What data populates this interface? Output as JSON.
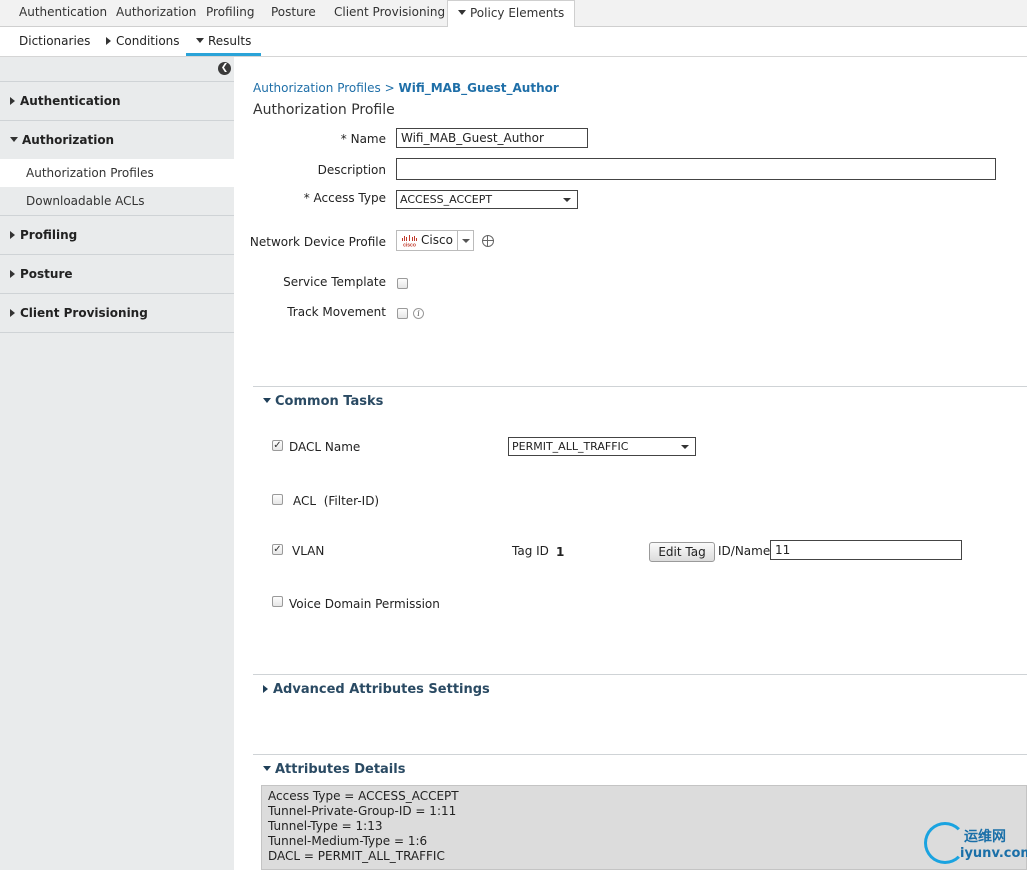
{
  "top_tabs": [
    "Authentication",
    "Authorization",
    "Profiling",
    "Posture",
    "Client Provisioning",
    "Policy Elements"
  ],
  "sub_tabs": {
    "dictionaries": "Dictionaries",
    "conditions": "Conditions",
    "results": "Results"
  },
  "sidebar": {
    "sections": [
      "Authentication",
      "Authorization",
      "Profiling",
      "Posture",
      "Client Provisioning"
    ],
    "authorization_items": [
      "Authorization Profiles",
      "Downloadable ACLs"
    ]
  },
  "breadcrumb": {
    "parent": "Authorization Profiles",
    "separator": ">",
    "current": "Wifi_MAB_Guest_Author"
  },
  "page_title": "Authorization Profile",
  "form": {
    "name_label": "* Name",
    "name_value": "Wifi_MAB_Guest_Author",
    "description_label": "Description",
    "description_value": "",
    "access_type_label": "* Access Type",
    "access_type_value": "ACCESS_ACCEPT",
    "ndp_label": "Network Device Profile",
    "ndp_logo_text": "cisco",
    "ndp_value": "Cisco",
    "service_template_label": "Service Template",
    "service_template_checked": false,
    "track_movement_label": "Track Movement",
    "track_movement_checked": false
  },
  "common_tasks": {
    "title": "Common Tasks",
    "dacl_label": "DACL Name",
    "dacl_checked": true,
    "dacl_value": "PERMIT_ALL_TRAFFIC",
    "acl_label": "ACL  (Filter-ID)",
    "acl_checked": false,
    "vlan_label": "VLAN",
    "vlan_checked": true,
    "tag_id_label": "Tag ID",
    "tag_id_value": "1",
    "edit_tag_label": "Edit Tag",
    "id_name_label": "ID/Name",
    "id_name_value": "11",
    "voice_label": "Voice Domain Permission",
    "voice_checked": false
  },
  "advanced": {
    "title": "Advanced Attributes Settings"
  },
  "attributes_details": {
    "title": "Attributes Details",
    "lines": [
      "Access Type = ACCESS_ACCEPT",
      "Tunnel-Private-Group-ID = 1:11",
      "Tunnel-Type = 1:13",
      "Tunnel-Medium-Type = 1:6",
      "DACL = PERMIT_ALL_TRAFFIC"
    ]
  },
  "watermark": {
    "cn": "运维网",
    "en": "iyunv.com"
  }
}
